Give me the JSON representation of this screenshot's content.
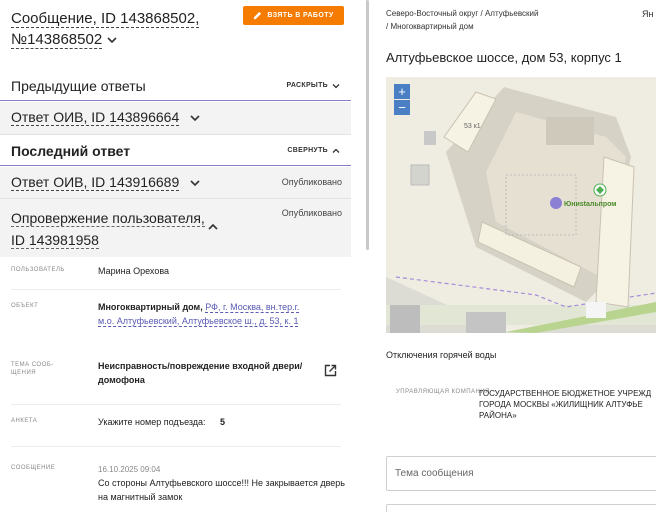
{
  "header": {
    "title": "Сообщение, ID 143868502, №143868502",
    "take_button": "ВЗЯТЬ В РАБОТУ"
  },
  "previous_answers": {
    "title": "Предыдущие ответы",
    "toggle": "РАСКРЫТЬ",
    "item": "Ответ ОИВ, ID 143896664"
  },
  "last_answer": {
    "title": "Последний ответ",
    "toggle": "СВЕРНУТЬ",
    "item": "Ответ ОИВ, ID 143916689",
    "item_status": "Опубликовано",
    "refutation": "Опровержение пользователя, ID 143981958",
    "refutation_status": "Опубликовано"
  },
  "fields": {
    "user_label": "ПОЛЬЗОВАТЕЛЬ",
    "user_value": "Марина Орехова",
    "object_label": "ОБЪЕКТ",
    "object_type": "Многоквартирный дом,",
    "object_address": "РФ, г. Москва, вн.тер.г. м.о. Алтуфьевский, Алтуфьевское ш., д. 53, к. 1",
    "topic_label": "ТЕМА СООБ-ЩЕНИЯ",
    "topic_value": "Неисправность/повреждение входной двери/домофона",
    "form_label": "АНКЕТА",
    "form_question": "Укажите номер подъезда:",
    "form_answer": "5",
    "message_label": "СООБЩЕНИЕ",
    "message_date": "16.10.2025 09:04",
    "message_text": "Со стороны Алтуфьевского шоссе!!! Не закрывается дверь на магнитный замок"
  },
  "right": {
    "breadcrumb_line1": "Северо-Восточный округ / Алтуфьевский",
    "breadcrumb_line2": "/ Многоквартирный дом",
    "lang": "Ян",
    "address": "Алтуфьевское шоссе, дом 53, корпус 1",
    "map": {
      "building_label": "53 к1",
      "poi_label": "Юниstальпром",
      "zoom_in": "+",
      "zoom_out": "−"
    },
    "hot_water": "Отключения горячей воды",
    "mc_label": "УПРАВЛЯЮЩАЯ КОМПАНИЯ",
    "mc_value": "ГОСУДАРСТВЕННОЕ БЮДЖЕТНОЕ УЧРЕЖД ГОРОДА МОСКВЫ «ЖИЛИЩНИК АЛТУФЬЕ РАЙОНА»",
    "topic_placeholder": "Тема сообщения"
  },
  "colors": {
    "accent_orange": "#f57c00",
    "link_purple": "#5a5ab4",
    "divider_purple": "#8a7fc7",
    "map_zoom_blue": "#4a7fc4"
  }
}
